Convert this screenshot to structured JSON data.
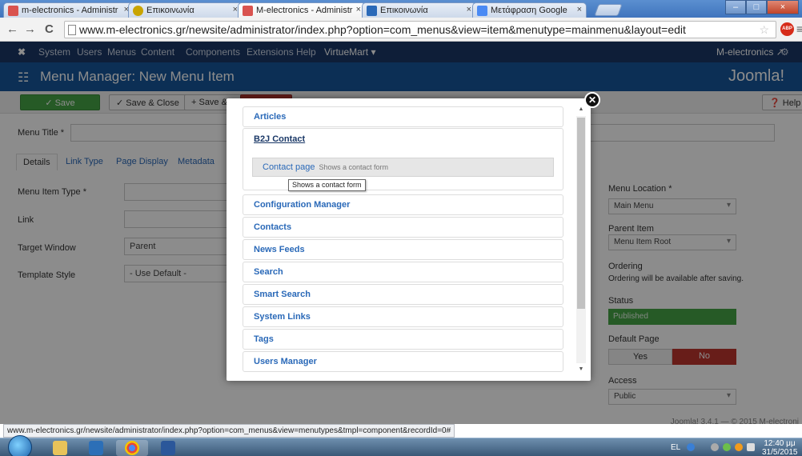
{
  "browser": {
    "tabs": [
      {
        "label": "m-electronics - Administr",
        "active": false
      },
      {
        "label": "Επικοινωνία",
        "active": false
      },
      {
        "label": "M-electronics - Administr",
        "active": true
      },
      {
        "label": "Επικοινωνία",
        "active": false
      },
      {
        "label": "Μετάφραση Google",
        "active": false
      }
    ],
    "tab_close": "×",
    "url": "www.m-electronics.gr/newsite/administrator/index.php?option=com_menus&view=item&menutype=mainmenu&layout=edit",
    "back": "←",
    "forward": "→",
    "reload": "C",
    "star": "☆",
    "menu": "≡",
    "abp": "ABP",
    "win_min": "–",
    "win_max": "□",
    "win_close": "×",
    "status_url": "www.m-electronics.gr/newsite/administrator/index.php?option=com_menus&view=menutypes&tmpl=component&recordId=0#"
  },
  "admin": {
    "nav": [
      "System",
      "Users",
      "Menus",
      "Content",
      "Components",
      "Extensions",
      "Help",
      "VirtueMart ▾"
    ],
    "site_link": "M-electronics ↗",
    "gear": "⚙",
    "hamburger": "☷",
    "page_title": "Menu Manager: New Menu Item",
    "logo": "Joomla!",
    "toolbar": {
      "save": "✓ Save",
      "save_close": "✓ Save & Close",
      "save_new": "+ Save & New",
      "cancel": "⊘ Cancel",
      "help": "❓ Help"
    },
    "menu_title_label": "Menu Title *",
    "form_tabs": [
      "Details",
      "Link Type",
      "Page Display",
      "Metadata"
    ],
    "fields": {
      "menu_item_type": "Menu Item Type *",
      "link": "Link",
      "target_window": "Target Window",
      "target_window_value": "Parent",
      "template_style": "Template Style",
      "template_style_value": "- Use Default -"
    },
    "right": {
      "menu_location_label": "Menu Location *",
      "menu_location_value": "Main Menu",
      "parent_item_label": "Parent Item",
      "parent_item_value": "Menu Item Root",
      "ordering_label": "Ordering",
      "ordering_note": "Ordering will be available after saving.",
      "status_label": "Status",
      "status_value": "Published",
      "default_page_label": "Default Page",
      "yes": "Yes",
      "no": "No",
      "access_label": "Access",
      "access_value": "Public"
    },
    "footer": "Joomla! 3.4.1 — © 2015 M-electroni"
  },
  "modal": {
    "close": "✕",
    "items_top": [
      {
        "label": "Articles"
      }
    ],
    "b2j_title": "B2J Contact",
    "contact_page": "Contact page",
    "contact_desc": "Shows a contact form",
    "tooltip": "Shows a contact form",
    "items": [
      {
        "label": "Configuration Manager"
      },
      {
        "label": "Contacts"
      },
      {
        "label": "News Feeds"
      },
      {
        "label": "Search"
      },
      {
        "label": "Smart Search"
      },
      {
        "label": "System Links"
      },
      {
        "label": "Tags"
      },
      {
        "label": "Users Manager"
      }
    ],
    "scroll_up": "▲",
    "scroll_down": "▼"
  },
  "taskbar": {
    "lang": "EL",
    "time": "12:40 μμ",
    "date": "31/5/2015"
  }
}
